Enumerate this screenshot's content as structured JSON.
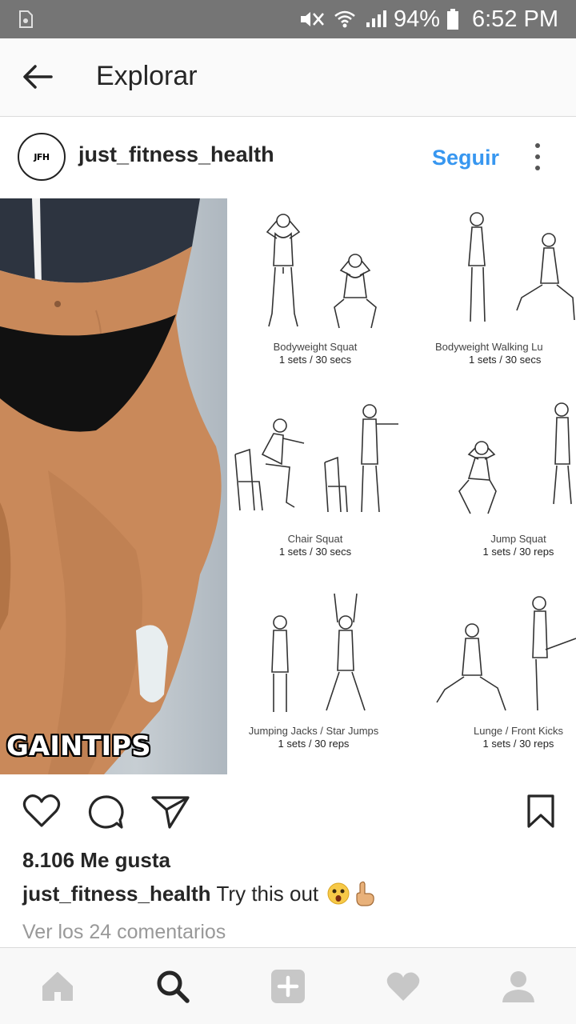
{
  "status_bar": {
    "battery": "94%",
    "time": "6:52 PM"
  },
  "header": {
    "title": "Explorar"
  },
  "post": {
    "avatar_text": "JFH",
    "username": "just_fitness_health",
    "follow_label": "Seguir",
    "overlay_text": "GAINTIPS",
    "exercises": [
      {
        "name": "Bodyweight Squat",
        "sets": "1 sets / 30 secs"
      },
      {
        "name": "Bodyweight Walking Lu",
        "sets": "1 sets / 30 secs"
      },
      {
        "name": "Chair Squat",
        "sets": "1 sets / 30 secs"
      },
      {
        "name": "Jump Squat",
        "sets": "1 sets / 30 reps"
      },
      {
        "name": "Jumping Jacks / Star Jumps",
        "sets": "1 sets / 30 reps"
      },
      {
        "name": "Lunge / Front Kicks",
        "sets": "1 sets / 30 reps"
      }
    ],
    "likes": "8.106 Me gusta",
    "caption_user": "just_fitness_health",
    "caption_text": "Try this out",
    "comments_link": "Ver los 24 comentarios"
  },
  "icons": {
    "back": "arrow-left-icon",
    "more": "more-vertical-icon",
    "like": "heart-outline-icon",
    "comment": "comment-icon",
    "share": "send-icon",
    "save": "bookmark-icon",
    "nav": [
      "home-icon",
      "search-icon",
      "add-icon",
      "heart-icon",
      "profile-icon"
    ]
  },
  "colors": {
    "accent": "#3897f0",
    "status_bar": "#757575"
  }
}
